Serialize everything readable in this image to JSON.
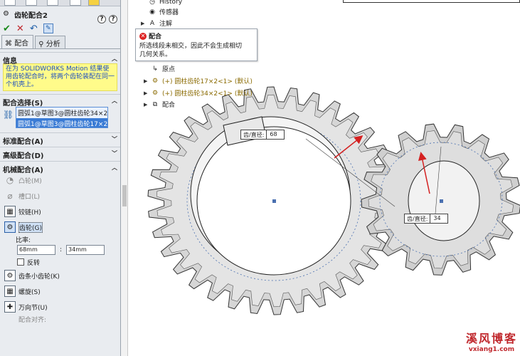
{
  "property_manager": {
    "title": "齿轮配合2",
    "help_label": "?",
    "tabs": [
      "配合",
      "分析"
    ],
    "info": {
      "header": "信息",
      "text": "在为 SOLIDWORKS Motion 结果使用齿轮配合时，将两个齿轮装配在同一个机壳上。"
    },
    "selections": {
      "header": "配合选择(S)",
      "items": [
        "圆弧1@草图3@圆柱齿轮34×2",
        "圆弧1@草图3@圆柱齿轮17×2"
      ]
    },
    "standard_header": "标准配合(A)",
    "advanced_header": "高级配合(D)",
    "mechanical": {
      "header": "机械配合(A)",
      "items": [
        {
          "label": "凸轮(M)",
          "icon": "cam-icon",
          "glyph": "◔",
          "enabled": false,
          "selected": false
        },
        {
          "label": "槽口(L)",
          "icon": "slot-icon",
          "glyph": "⌀",
          "enabled": false,
          "selected": false
        },
        {
          "label": "铰链(H)",
          "icon": "hinge-icon",
          "glyph": "▦",
          "enabled": true,
          "selected": false
        },
        {
          "label": "齿轮(G)",
          "icon": "gear-icon",
          "glyph": "⚙",
          "enabled": true,
          "selected": true
        }
      ],
      "ratio_label": "比率:",
      "ratio_left": "68mm",
      "ratio_right": "34mm",
      "ratio_sep": ":",
      "reverse_label": "反转",
      "items_after": [
        {
          "label": "齿条小齿轮(K)",
          "icon": "rack-pinion-icon",
          "glyph": "⚙"
        },
        {
          "label": "螺旋(S)",
          "icon": "screw-icon",
          "glyph": "▦"
        },
        {
          "label": "万向节(U)",
          "icon": "universal-joint-icon",
          "glyph": "✚"
        }
      ],
      "align_label": "配合对齐:"
    }
  },
  "feature_tree": [
    {
      "label": "History",
      "icon": "history-icon",
      "glyph": "◷",
      "arrow": "",
      "kind": ""
    },
    {
      "label": "传感器",
      "icon": "sensor-icon",
      "glyph": "◉",
      "arrow": "",
      "kind": ""
    },
    {
      "label": "注解",
      "icon": "annotation-icon",
      "glyph": "A",
      "arrow": "▶",
      "kind": ""
    },
    {
      "label": "原点",
      "icon": "origin-icon",
      "glyph": "↳",
      "arrow": "",
      "kind": ""
    },
    {
      "label": "(+) 圆柱齿轮17×2<1> (默认)",
      "icon": "part-icon",
      "glyph": "⚙",
      "arrow": "▶",
      "kind": "mate"
    },
    {
      "label": "(+) 圆柱齿轮34×2<1> (默认)",
      "icon": "part-icon",
      "glyph": "⚙",
      "arrow": "▶",
      "kind": "mate"
    },
    {
      "label": "配合",
      "icon": "mates-icon",
      "glyph": "⧉",
      "arrow": "▶",
      "kind": ""
    }
  ],
  "tooltip": {
    "title": "配合",
    "message_line1": "所选线段未相交，因此不会生成相切",
    "message_line2": "几何关系。"
  },
  "dimensions": [
    {
      "label": "齿/直径:",
      "value": "68"
    },
    {
      "label": "齿/直径:",
      "value": "34"
    }
  ],
  "watermark": {
    "line1": "溪风博客",
    "line2": "vxiang1.com"
  },
  "colors": {
    "accent": "#3a7bd5",
    "error": "#c0282d",
    "info_bg": "#fffb8a",
    "annotation_arrow": "#d42020"
  }
}
